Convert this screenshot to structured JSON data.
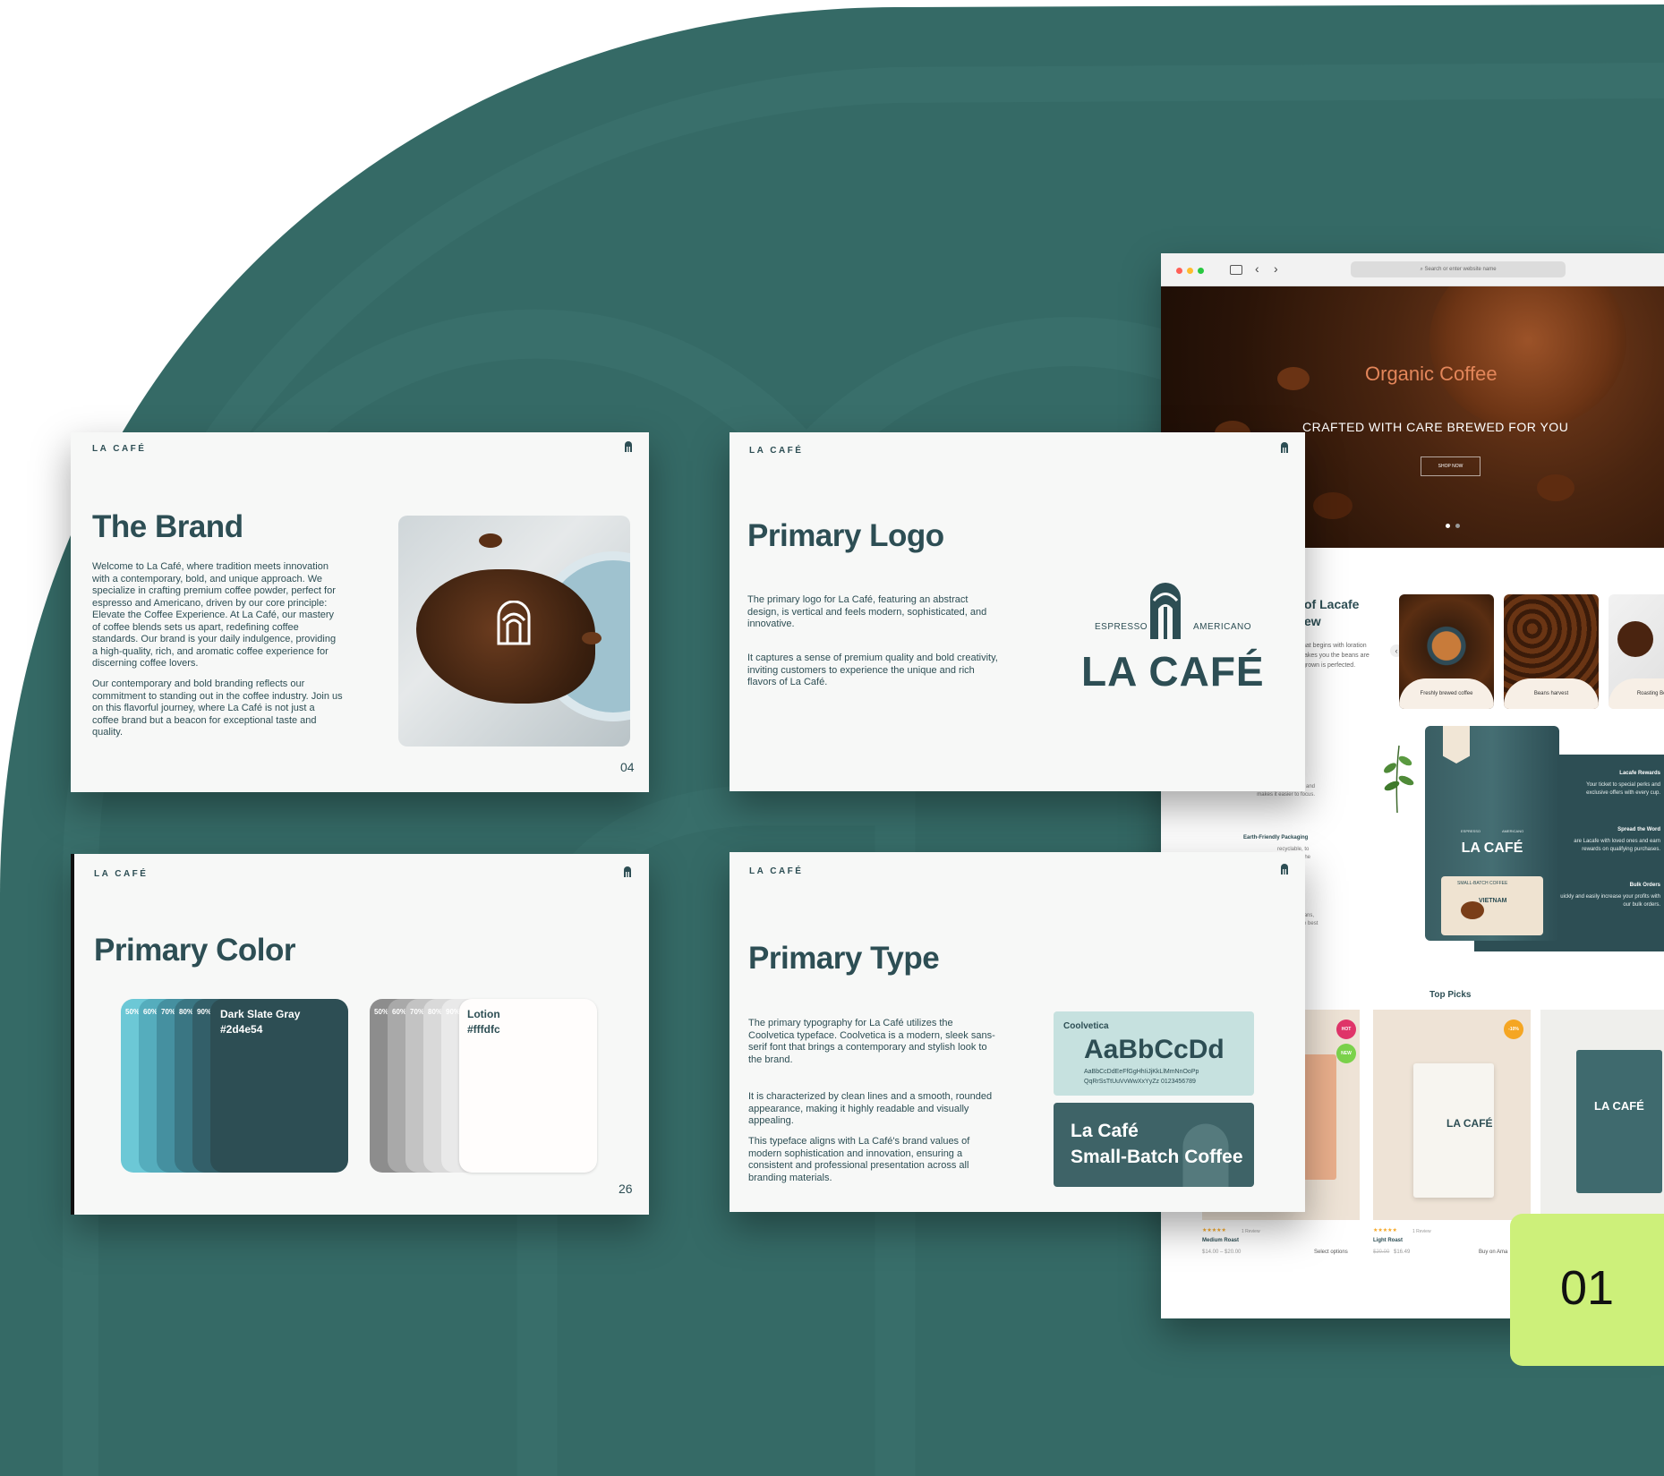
{
  "colors": {
    "dark_slate": "#2d4e54",
    "lotion": "#fffdfc",
    "background_teal": "#356a66",
    "lime": "#cdf07a"
  },
  "brand_slide": {
    "brandmark": "LA CAFÉ",
    "title": "The Brand",
    "paragraphs": [
      "Welcome to La Café, where tradition meets innovation with a contemporary, bold, and unique approach. We specialize in crafting premium coffee powder, perfect for espresso and Americano, driven by our core principle: Elevate the Coffee Experience. At La Café, our mastery of coffee blends sets us apart, redefining coffee standards. Our brand is your daily indulgence, providing a high-quality, rich, and aromatic coffee experience for discerning coffee lovers.",
      "Our contemporary and bold branding reflects our commitment to standing out in the coffee industry. Join us on this flavorful journey, where La Café is not just a coffee brand but a beacon for exceptional taste and quality."
    ],
    "page": "04",
    "image_icon": "coffee-grounds-photo"
  },
  "logo_slide": {
    "brandmark": "LA CAFÉ",
    "title": "Primary Logo",
    "paragraphs": [
      "The primary logo for La Café, featuring an abstract design, is vertical and feels modern, sophisticated, and innovative.",
      "It captures a sense of premium quality and bold creativity, inviting customers to experience the unique and rich flavors of La Café."
    ],
    "logo_left": "ESPRESSO",
    "logo_right": "AMERICANO",
    "logo_word": "LA CAFÉ"
  },
  "color_slide": {
    "brandmark": "LA CAFÉ",
    "title": "Primary Color",
    "dark_tints": [
      "50%",
      "60%",
      "70%",
      "80%",
      "90%"
    ],
    "dark_name": "Dark Slate Gray",
    "dark_hex": "#2d4e54",
    "light_tints": [
      "50%",
      "60%",
      "70%",
      "80%",
      "90%"
    ],
    "light_name": "Lotion",
    "light_hex": "#fffdfc",
    "page": "26"
  },
  "type_slide": {
    "brandmark": "LA CAFÉ",
    "title": "Primary Type",
    "paragraphs": [
      "The primary typography for La Café utilizes the Coolvetica typeface. Coolvetica is a modern, sleek sans-serif font that brings a contemporary and stylish look to the brand.",
      "It is characterized by clean lines and a smooth, rounded appearance, making it highly readable and visually appealing.",
      "This typeface aligns with La Café's brand values of modern sophistication and innovation, ensuring a consistent and professional presentation across all branding materials."
    ],
    "font_name": "Coolvetica",
    "sample_big": "AaBbCcDd",
    "sample_line1": "AaBbCcDdEeFfGgHhIiJjKkLlMmNnOoPp",
    "sample_line2": "QqRrSsTtUuVvWwXxYyZz 0123456789",
    "sample_dark_1": "La Café",
    "sample_dark_2": "Small-Batch Coffee"
  },
  "browser": {
    "search_placeholder": "Search or enter website name",
    "hero_title": "Organic Coffee",
    "hero_subtitle": "CRAFTED WITH CARE BREWED FOR YOU",
    "hero_button": "SHOP NOW",
    "section_heading_1": "of Lacafe",
    "section_heading_2": "ew",
    "section_text": "hat begins with loration takes you the beans are grown is perfected.",
    "thumbs": [
      "Freshly brewed coffee",
      "Beans harvest",
      "Roasting Beans"
    ],
    "features_left": [
      {
        "title": "",
        "text": "energy, helps you stay calm and makes it easier to focus."
      },
      {
        "title": "Earth-Friendly Packaging",
        "text": "recyclable, to reduce for the planet."
      },
      {
        "title": "",
        "text": "the best beans, give you the best"
      }
    ],
    "features_right": [
      {
        "title": "Lacafe Rewards",
        "text": "Your ticket to special perks and exclusive offers with every cup."
      },
      {
        "title": "Spread the Word",
        "text": "are Lacafe with loved ones and earn rewards on qualifying purchases."
      },
      {
        "title": "Bulk Orders",
        "text": "uickly and easily increase your profits with our bulk orders."
      }
    ],
    "pack_brand": "LA CAFÉ",
    "pack_tag_left": "ESPRESSO",
    "pack_tag_right": "AMERICANO",
    "pack_label": "SMALL-BATCH COFFEE",
    "pack_origin": "VIETNAM",
    "top_picks": "Top Picks",
    "badges": [
      "HOT",
      "NEW",
      "-10%"
    ],
    "products": [
      {
        "name": "Medium Roast",
        "reviews": "1 Review",
        "price": "$14.00 – $20.00",
        "action": "Select options"
      },
      {
        "name": "Light Roast",
        "reviews": "1 Review",
        "old_price": "$20.00",
        "price": "$16.49",
        "action": "Buy on Ama"
      }
    ],
    "stars": "★★★★★"
  },
  "badge_number": "01"
}
